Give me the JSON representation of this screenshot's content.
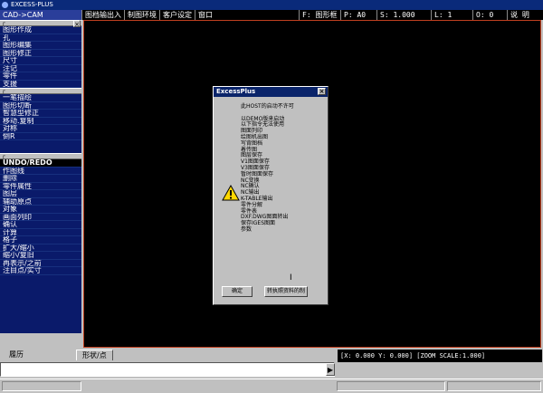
{
  "window": {
    "title": "EXCESS-PLUS"
  },
  "topbar": {
    "mode_label": "CAD->CAM",
    "menus": [
      "图档输出入",
      "制图环境",
      "客户设定",
      "窗口"
    ],
    "status": {
      "layer": "F: 图形框",
      "pen": "P: A0",
      "scale": "S: 1.000",
      "line": "L: 1",
      "origin": "O: 0",
      "help": "说  明"
    }
  },
  "leftpanel": {
    "close_glyph": "×",
    "group1": [
      "图形作成",
      "孔",
      "图形编集",
      "图形修正",
      "尺寸",
      "注记",
      "零件",
      "支援"
    ],
    "group2": [
      "一笔描绘",
      "图形切断",
      "智慧型修正",
      "移动.复制",
      "对称",
      "倒R"
    ],
    "group3_header": "UNDO/REDO",
    "group3": [
      "作图线",
      "删除",
      "零件属性",
      "图层",
      "辅助原点",
      "对象",
      "画面列印",
      "确认",
      "计算",
      "格子",
      "扩大/缩小",
      "缩小/复旧",
      "再表示/之前",
      "注目点/实寸"
    ]
  },
  "dialog": {
    "title": "ExcessPlus",
    "close_glyph": "×",
    "lines": [
      "此HOST的启动不许可",
      "",
      "以DEMO版来启动",
      "以下指令无法使用",
      "  图面列印",
      "  绘图机出图",
      "  写背图档",
      "  着传图",
      "  图层保存",
      "  V1图面保存",
      "  V3图面保存",
      "  暂时图面保存",
      "  NC变换",
      "  NC确认",
      "  NC输出",
      "  K-TABLE输出",
      "  零件分解",
      "  零件表",
      "  DXF.DWG图面转出",
      "  保存IGES图面",
      "  参数"
    ],
    "ok_label": "确定",
    "info_label": "转执照资料的制"
  },
  "bottom": {
    "tabs": [
      "履历",
      "形状/点"
    ],
    "coords": "[X:      0.000 Y:      0.000] [ZOOM SCALE:1.000]",
    "cmd_arrow": "▶"
  },
  "colors": {
    "panel_blue": "#0a1a6a",
    "title_blue": "#0a246a",
    "canvas": "#000000",
    "canvas_border": "#c04020",
    "face": "#c0c0c0"
  }
}
